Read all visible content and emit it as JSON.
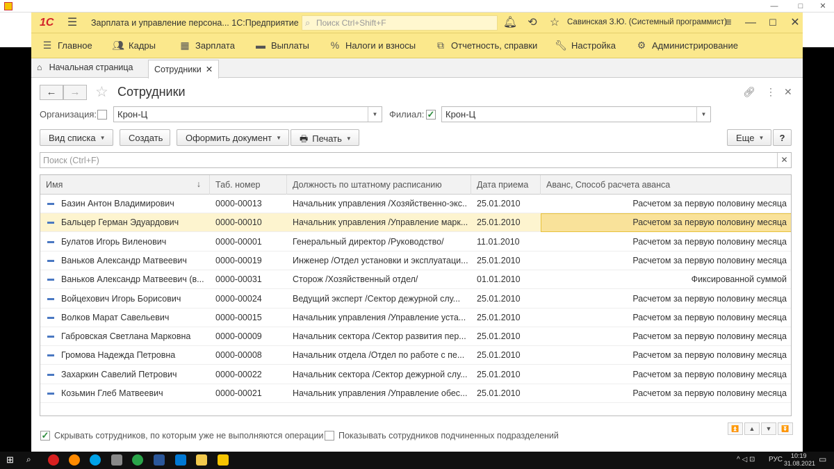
{
  "window": {
    "title_bar_icon": "app-icon"
  },
  "app": {
    "logo": "1С",
    "title": "Зарплата и управление персона... 1С:Предприятие",
    "search_placeholder": "Поиск Ctrl+Shift+F",
    "user": "Савинская З.Ю. (Системный программист)"
  },
  "sections": [
    {
      "label": "Главное",
      "icon": "menu-icon"
    },
    {
      "label": "Кадры",
      "icon": "people-icon"
    },
    {
      "label": "Зарплата",
      "icon": "calculator-icon"
    },
    {
      "label": "Выплаты",
      "icon": "wallet-icon"
    },
    {
      "label": "Налоги и взносы",
      "icon": "percent-icon"
    },
    {
      "label": "Отчетность, справки",
      "icon": "reports-icon"
    },
    {
      "label": "Настройка",
      "icon": "wrench-icon"
    },
    {
      "label": "Администрирование",
      "icon": "gear-icon"
    }
  ],
  "tabs": {
    "home": "Начальная страница",
    "active": "Сотрудники"
  },
  "form": {
    "title": "Сотрудники",
    "org_label": "Организация:",
    "org_value": "Крон-Ц",
    "branch_label": "Филиал:",
    "branch_value": "Крон-Ц",
    "buttons": {
      "view": "Вид списка",
      "create": "Создать",
      "doc": "Оформить документ",
      "print": "Печать",
      "more": "Еще",
      "help": "?"
    },
    "search_placeholder": "Поиск (Ctrl+F)"
  },
  "table": {
    "headers": [
      "Имя",
      "Таб. номер",
      "Должность по штатному расписанию",
      "Дата приема",
      "Аванс, Способ расчета аванса"
    ],
    "rows": [
      {
        "name": "Базин Антон Владимирович",
        "num": "0000-00013",
        "pos": "Начальник управления /Хозяйственно-экс...",
        "date": "25.01.2010",
        "adv": "Расчетом за первую половину месяца"
      },
      {
        "name": "Бальцер Герман Эдуардович",
        "num": "0000-00010",
        "pos": "Начальник управления /Управление марк...",
        "date": "25.01.2010",
        "adv": "Расчетом за первую половину месяца"
      },
      {
        "name": "Булатов Игорь Виленович",
        "num": "0000-00001",
        "pos": "Генеральный директор /Руководство/",
        "date": "11.01.2010",
        "adv": "Расчетом за первую половину месяца"
      },
      {
        "name": "Ваньков Александр Матвеевич",
        "num": "0000-00019",
        "pos": "Инженер /Отдел установки и эксплуатаци...",
        "date": "25.01.2010",
        "adv": "Расчетом за первую половину месяца"
      },
      {
        "name": "Ваньков Александр Матвеевич (в...",
        "num": "0000-00031",
        "pos": "Сторож /Хозяйственный отдел/",
        "date": "01.01.2010",
        "adv": "Фиксированной суммой"
      },
      {
        "name": "Войцехович Игорь Борисович",
        "num": "0000-00024",
        "pos": "Ведущий эксперт /Сектор дежурной слу...",
        "date": "25.01.2010",
        "adv": "Расчетом за первую половину месяца"
      },
      {
        "name": "Волков Марат Савельевич",
        "num": "0000-00015",
        "pos": "Начальник управления /Управление уста...",
        "date": "25.01.2010",
        "adv": "Расчетом за первую половину месяца"
      },
      {
        "name": "Габровская Светлана Марковна",
        "num": "0000-00009",
        "pos": "Начальник сектора /Сектор развития пер...",
        "date": "25.01.2010",
        "adv": "Расчетом за первую половину месяца"
      },
      {
        "name": "Громова Надежда Петровна",
        "num": "0000-00008",
        "pos": "Начальник отдела /Отдел по работе с пе...",
        "date": "25.01.2010",
        "adv": "Расчетом за первую половину месяца"
      },
      {
        "name": "Захаркин Савелий Петрович",
        "num": "0000-00022",
        "pos": "Начальник сектора /Сектор дежурной слу...",
        "date": "25.01.2010",
        "adv": "Расчетом за первую половину месяца"
      },
      {
        "name": "Козьмин Глеб Матвеевич",
        "num": "0000-00021",
        "pos": "Начальник управления /Управление обес...",
        "date": "25.01.2010",
        "adv": "Расчетом за первую половину месяца"
      }
    ],
    "selected_index": 1
  },
  "footer": {
    "hide_label": "Скрывать сотрудников, по которым уже не выполняются операции",
    "show_label": "Показывать сотрудников подчиненных подразделений"
  },
  "taskbar": {
    "lang": "РУС",
    "time": "10:19",
    "date": "31.08.2021"
  }
}
